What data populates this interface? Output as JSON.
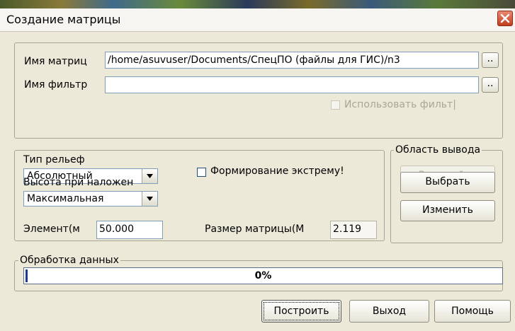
{
  "window": {
    "title": "Создание матрицы"
  },
  "matrix": {
    "name_label": "Имя матриц",
    "name_value": "/home/asuvuser/Documents/СпецПО (файлы для ГИС)/n3",
    "filter_label": "Имя фильтр",
    "filter_value": "",
    "browse_label": "..",
    "use_filter_label": "Использовать фильт|"
  },
  "relief": {
    "type_label": "Тип рельеф",
    "type_value": "Абсолютный",
    "height_label": "Высота при наложен",
    "height_value": "Максимальная",
    "extremum_label": "Формирование экстрему!",
    "element_label": "Элемент(м",
    "element_value": "50.000",
    "size_label": "Размер матрицы(М",
    "size_value": "2.119"
  },
  "output": {
    "legend": "Область вывода",
    "whole_region": "Весь район",
    "select": "Выбрать",
    "change": "Изменить"
  },
  "processing": {
    "legend": "Обработка данных",
    "progress_text": "0%",
    "progress_fraction": 0.0
  },
  "footer": {
    "build": "Построить",
    "exit": "Выход",
    "help": "Помощь"
  },
  "colors": {
    "progress_fill": "#1a3a9a",
    "close_button": "#c43d1f"
  }
}
